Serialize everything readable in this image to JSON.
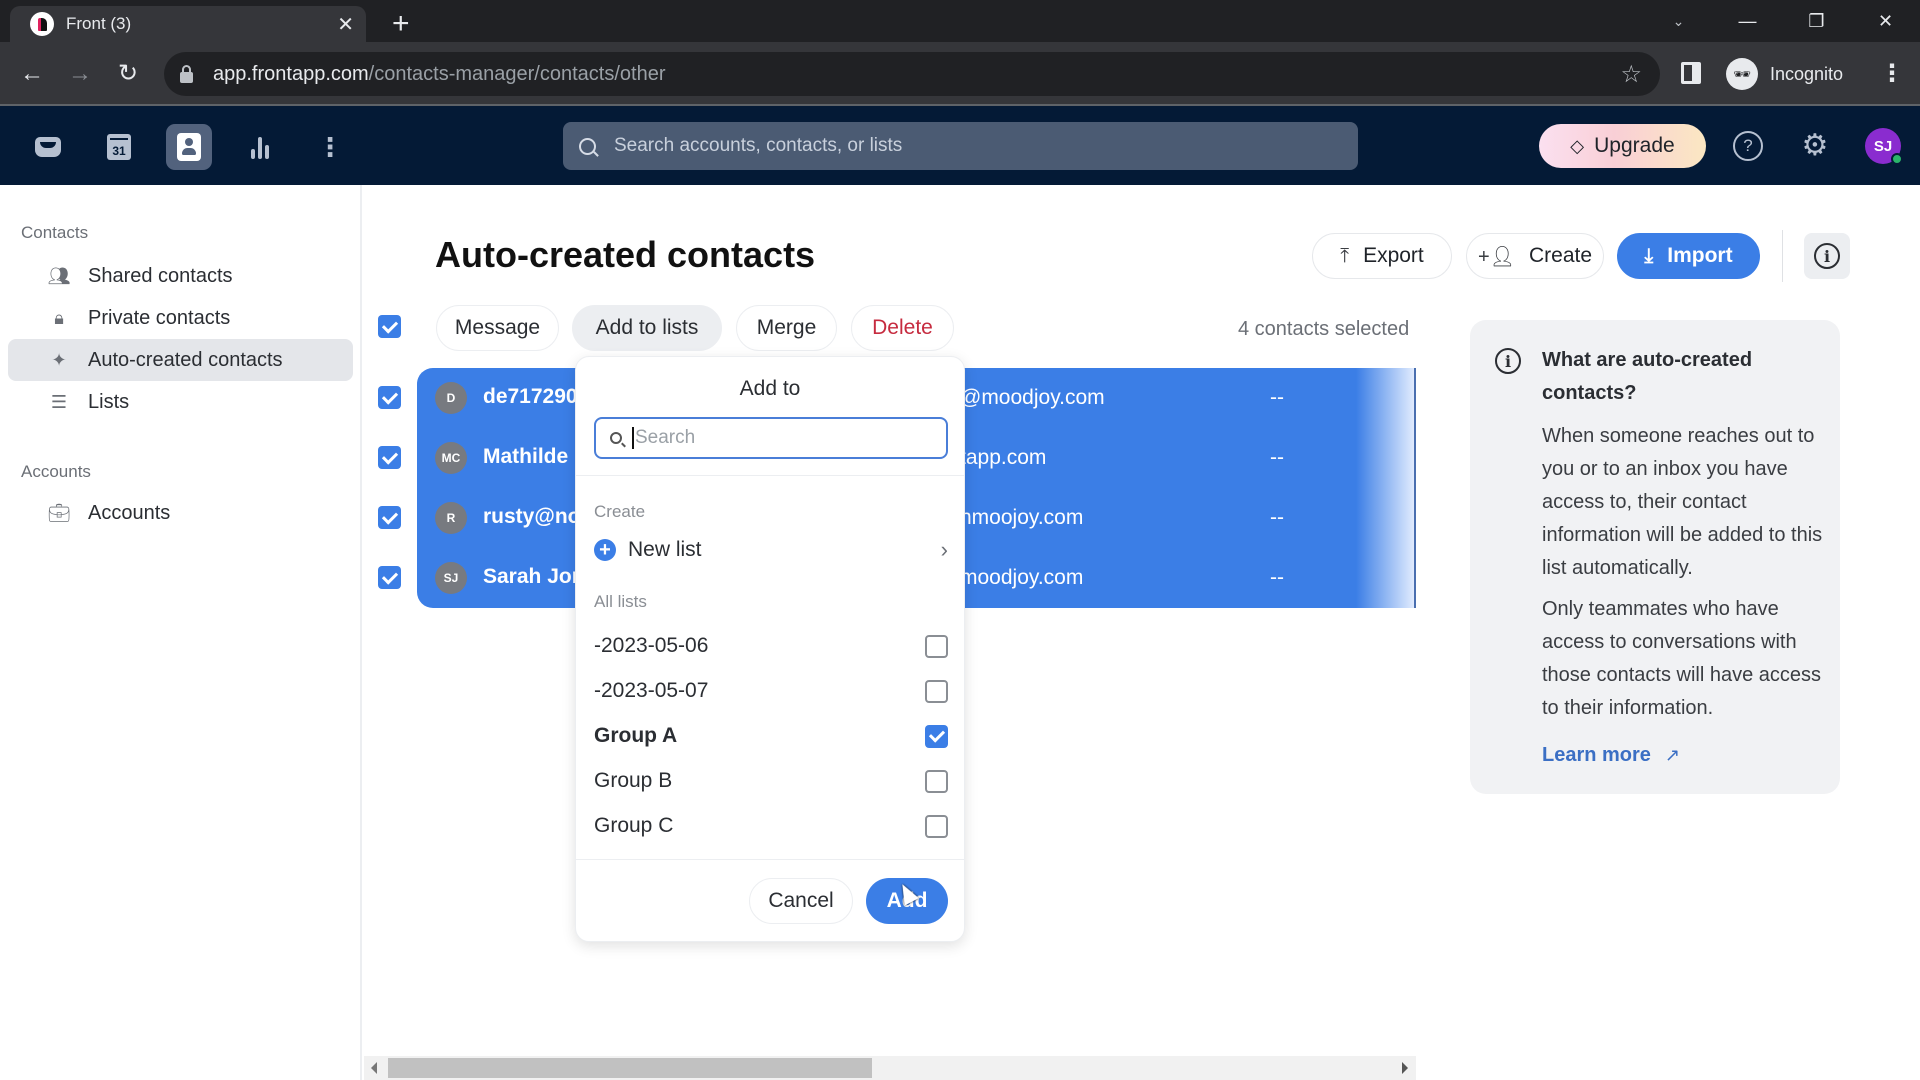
{
  "browser": {
    "tab_title": "Front (3)",
    "tab_close": "✕",
    "new_tab": "+",
    "url_host": "app.frontapp.com",
    "url_path": "/contacts-manager/contacts/other",
    "profile_label": "Incognito",
    "window_controls": {
      "dropdown": "⌄",
      "minimize": "—",
      "restore": "❐",
      "close": "✕"
    }
  },
  "app_header": {
    "nav_icons": [
      "inbox-icon",
      "calendar-icon",
      "contacts-icon",
      "analytics-icon",
      "more-icon"
    ],
    "calendar_day": "31",
    "search_placeholder": "Search accounts, contacts, or lists",
    "upgrade_label": "Upgrade",
    "avatar_initials": "SJ",
    "avatar_color": "#8a2ccf"
  },
  "sidebar": {
    "contacts_section": "Contacts",
    "contacts_items": [
      {
        "label": "Shared contacts",
        "icon": "users-icon",
        "active": false
      },
      {
        "label": "Private contacts",
        "icon": "lock-icon",
        "active": false
      },
      {
        "label": "Auto-created contacts",
        "icon": "sparkle-icon",
        "active": true
      },
      {
        "label": "Lists",
        "icon": "list-icon",
        "active": false
      }
    ],
    "accounts_section": "Accounts",
    "accounts_items": [
      {
        "label": "Accounts",
        "icon": "briefcase-icon",
        "active": false
      }
    ]
  },
  "main": {
    "title": "Auto-created contacts",
    "top_actions": {
      "export": "Export",
      "create": "Create",
      "import": "Import"
    },
    "bulk_actions": {
      "message": "Message",
      "add_to_lists": "Add to lists",
      "merge": "Merge",
      "delete": "Delete"
    },
    "selection_count": "4 contacts selected",
    "accent_color": "#3b7ee6",
    "rows": [
      {
        "initials": "D",
        "name": "de717290",
        "email": "@moodjoy.com",
        "phone": "--",
        "selected": true
      },
      {
        "initials": "MC",
        "name": "Mathilde",
        "email": "tapp.com",
        "phone": "--",
        "selected": true
      },
      {
        "initials": "R",
        "name": "rusty@no",
        "email": "nmoojoy.com",
        "phone": "--",
        "selected": true
      },
      {
        "initials": "SJ",
        "name": "Sarah Jon",
        "email": "moodjoy.com",
        "phone": "--",
        "selected": true
      }
    ]
  },
  "add_to_popover": {
    "title": "Add to",
    "search_placeholder": "Search",
    "search_value": "",
    "create_label": "Create",
    "new_list_label": "New list",
    "all_lists_label": "All lists",
    "lists": [
      {
        "name": "-2023-05-06",
        "checked": false
      },
      {
        "name": "-2023-05-07",
        "checked": false
      },
      {
        "name": "Group A",
        "checked": true
      },
      {
        "name": "Group B",
        "checked": false
      },
      {
        "name": "Group C",
        "checked": false
      }
    ],
    "cancel_label": "Cancel",
    "add_label": "Add"
  },
  "info_panel": {
    "title": "What are auto-created contacts?",
    "paragraph1": "When someone reaches out to you or to an inbox you have access to, their contact information will be added to this list automatically.",
    "paragraph2": "Only teammates who have access to conversations with those contacts will have access to their information.",
    "learn_more": "Learn more"
  }
}
